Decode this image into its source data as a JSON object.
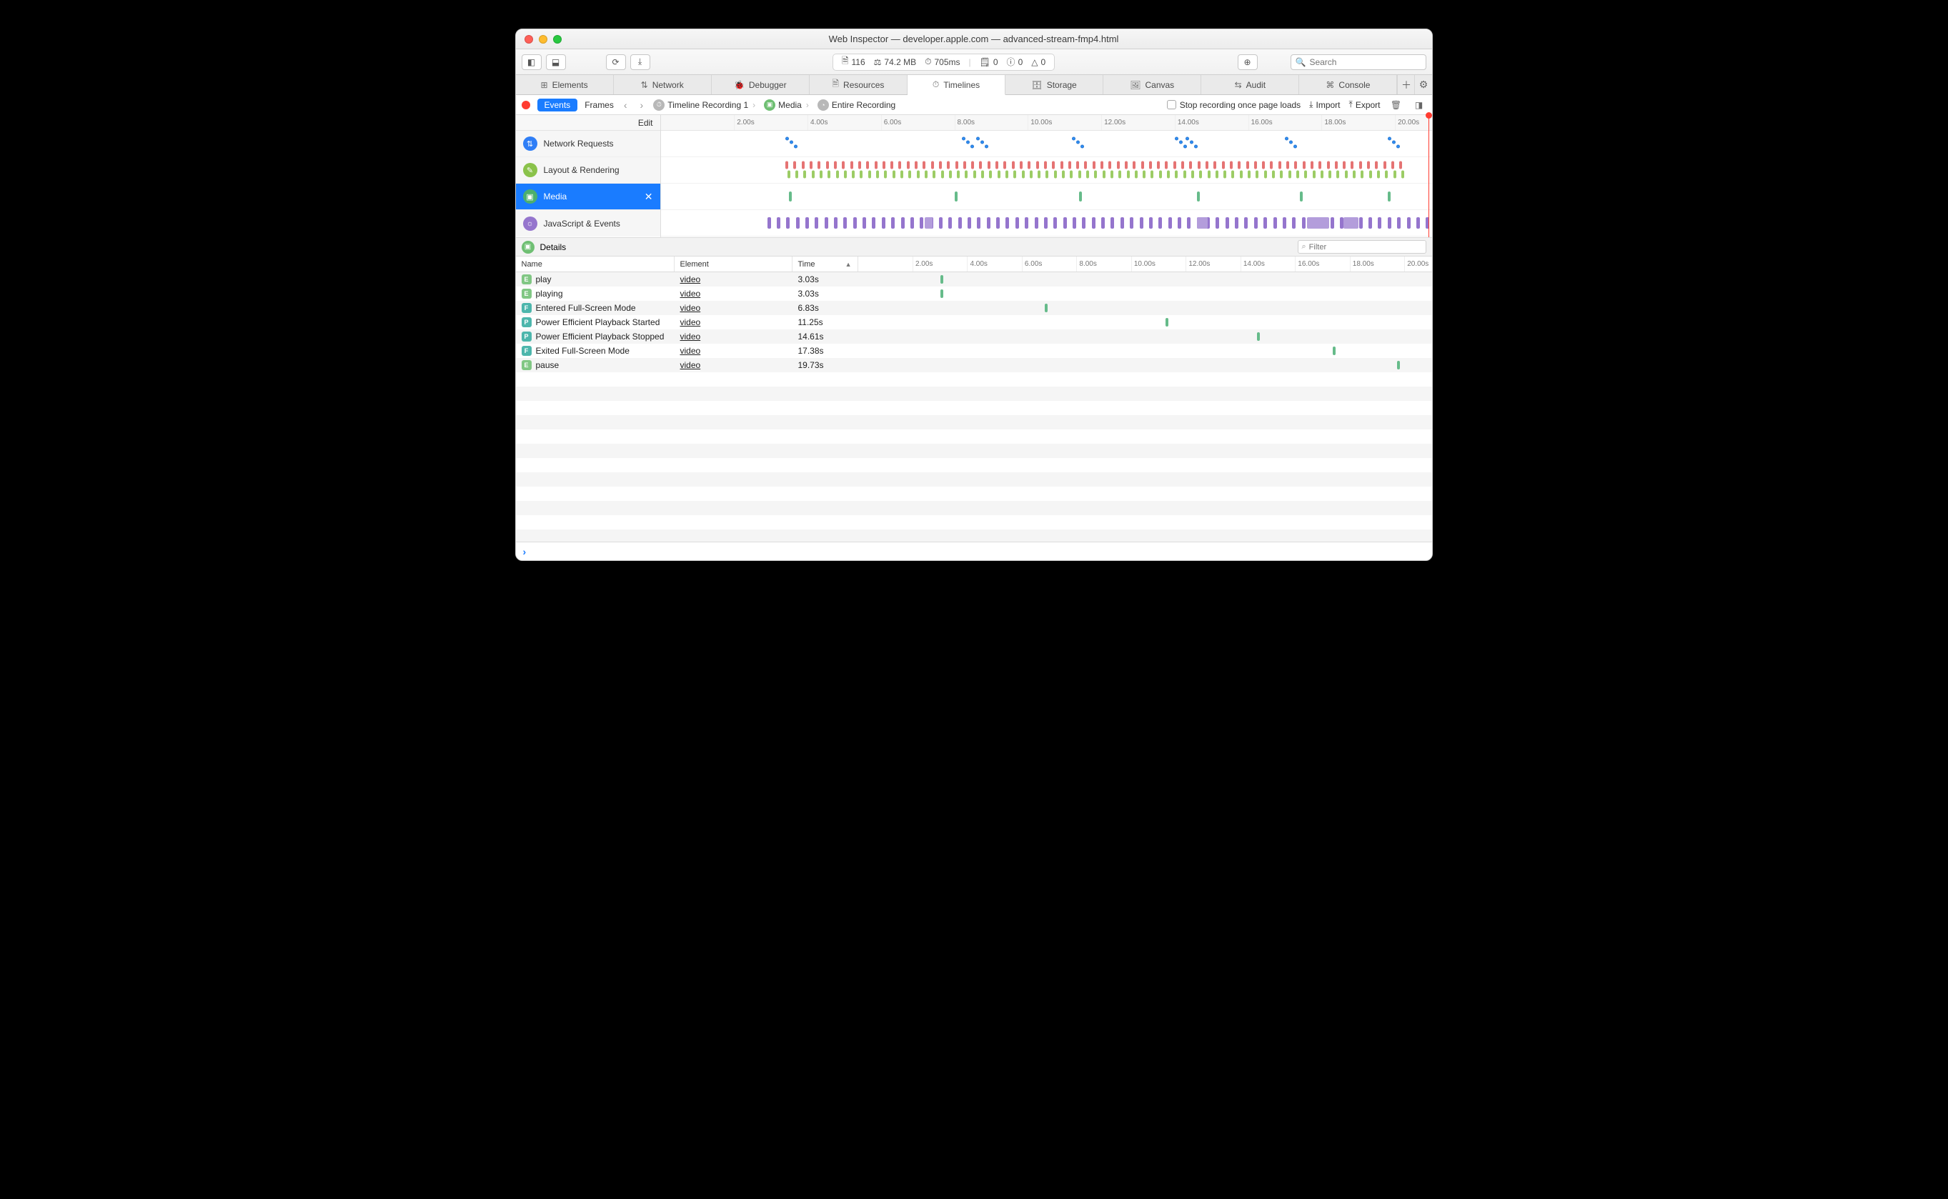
{
  "window_title": "Web Inspector — developer.apple.com — advanced-stream-fmp4.html",
  "dashboard": {
    "resources": "116",
    "size": "74.2 MB",
    "time": "705ms",
    "logs": "0",
    "errors": "0",
    "warnings": "0"
  },
  "search_placeholder": "Search",
  "tabs": [
    "Elements",
    "Network",
    "Debugger",
    "Resources",
    "Timelines",
    "Storage",
    "Canvas",
    "Audit",
    "Console"
  ],
  "active_tab": "Timelines",
  "scope": {
    "events": "Events",
    "frames": "Frames",
    "crumbs": [
      "Timeline Recording 1",
      "Media",
      "Entire Recording"
    ],
    "stop_label": "Stop recording once page loads",
    "import": "Import",
    "export": "Export"
  },
  "overview": {
    "edit": "Edit",
    "ticks": [
      "2.00s",
      "4.00s",
      "6.00s",
      "8.00s",
      "10.00s",
      "12.00s",
      "14.00s",
      "16.00s",
      "18.00s",
      "20.00s"
    ],
    "tracks": [
      {
        "label": "Network Requests",
        "icon": "blue"
      },
      {
        "label": "Layout & Rendering",
        "icon": "greenl"
      },
      {
        "label": "Media",
        "icon": "greend",
        "selected": true
      },
      {
        "label": "JavaScript & Events",
        "icon": "purple"
      }
    ]
  },
  "details_label": "Details",
  "filter_placeholder": "Filter",
  "table": {
    "headers": {
      "name": "Name",
      "element": "Element",
      "time": "Time"
    },
    "rows": [
      {
        "badge": "E",
        "name": "play",
        "element": "video",
        "time": "3.03s",
        "t": 3.03
      },
      {
        "badge": "E",
        "name": "playing",
        "element": "video",
        "time": "3.03s",
        "t": 3.03
      },
      {
        "badge": "F",
        "name": "Entered Full-Screen Mode",
        "element": "video",
        "time": "6.83s",
        "t": 6.83
      },
      {
        "badge": "P",
        "name": "Power Efficient Playback Started",
        "element": "video",
        "time": "11.25s",
        "t": 11.25
      },
      {
        "badge": "P",
        "name": "Power Efficient Playback Stopped",
        "element": "video",
        "time": "14.61s",
        "t": 14.61
      },
      {
        "badge": "F",
        "name": "Exited Full-Screen Mode",
        "element": "video",
        "time": "17.38s",
        "t": 17.38
      },
      {
        "badge": "E",
        "name": "pause",
        "element": "video",
        "time": "19.73s",
        "t": 19.73
      }
    ]
  },
  "chart_data": {
    "type": "timeline",
    "x_range": [
      0,
      21
    ],
    "x_ticks": [
      2,
      4,
      6,
      8,
      10,
      12,
      14,
      16,
      18,
      20
    ],
    "tracks": {
      "network_requests": {
        "clusters_s": [
          3.4,
          8.2,
          8.6,
          11.2,
          14.0,
          14.3,
          17.0,
          19.8
        ],
        "style": "dots"
      },
      "layout_rendering": {
        "range_s": [
          3.4,
          20.2
        ],
        "density": "dense",
        "colors": [
          "red",
          "green"
        ]
      },
      "media": {
        "events_s": [
          3.5,
          8.0,
          11.4,
          14.6,
          17.4,
          19.8
        ]
      },
      "javascript_events": {
        "range_s": [
          2.8,
          21.0
        ],
        "density": "dense",
        "color": "purple",
        "wide_blocks_s": [
          [
            7.2,
            7.4
          ],
          [
            14.6,
            14.9
          ],
          [
            17.6,
            18.2
          ],
          [
            18.6,
            19.0
          ]
        ]
      }
    },
    "media_events": [
      {
        "label": "play",
        "t": 3.03
      },
      {
        "label": "playing",
        "t": 3.03
      },
      {
        "label": "Entered Full-Screen Mode",
        "t": 6.83
      },
      {
        "label": "Power Efficient Playback Started",
        "t": 11.25
      },
      {
        "label": "Power Efficient Playback Stopped",
        "t": 14.61
      },
      {
        "label": "Exited Full-Screen Mode",
        "t": 17.38
      },
      {
        "label": "pause",
        "t": 19.73
      }
    ]
  }
}
